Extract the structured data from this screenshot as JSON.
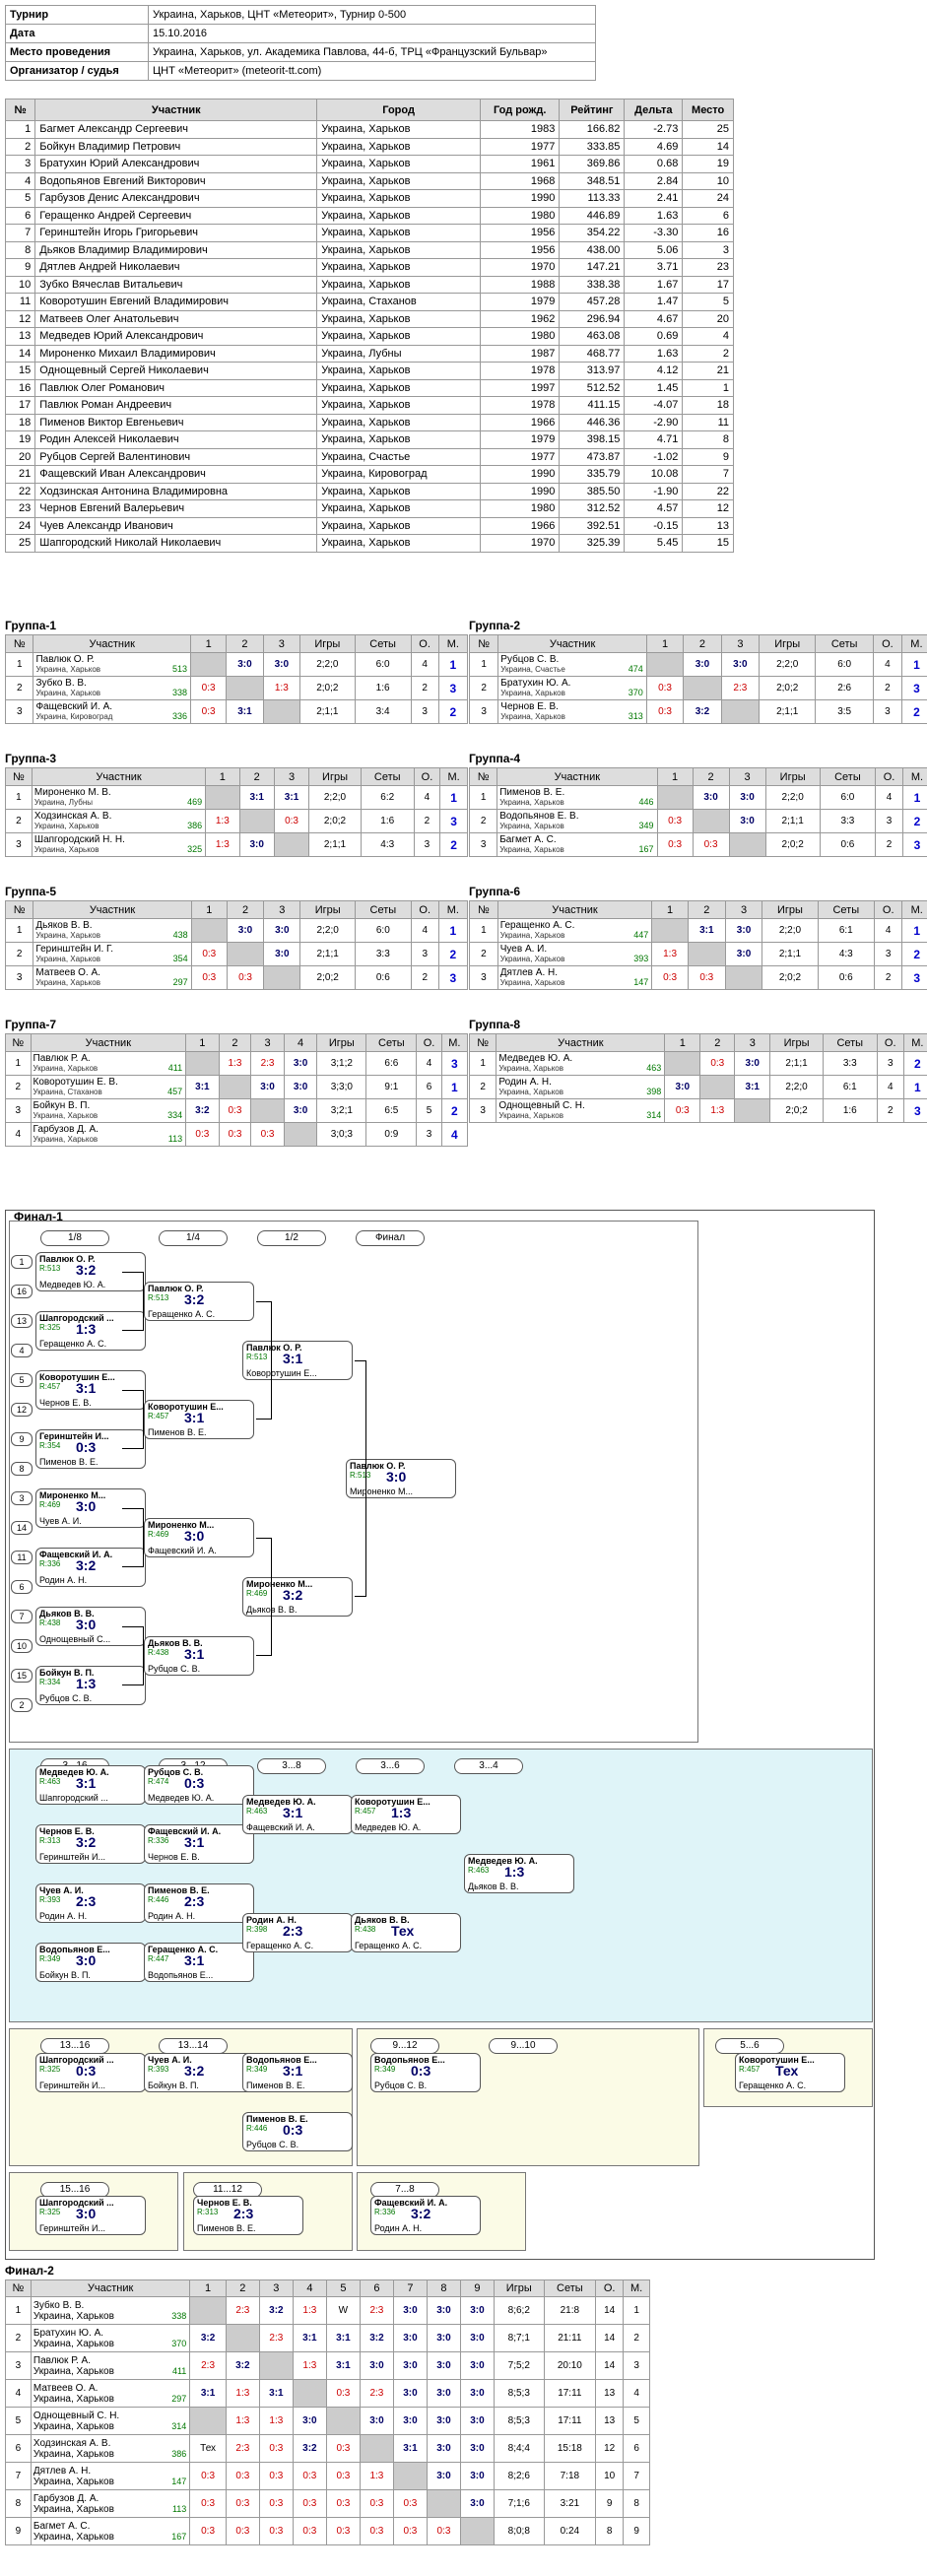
{
  "info": [
    [
      "Турнир",
      "Украина, Харьков, ЦНТ «Метеорит», Турнир 0-500"
    ],
    [
      "Дата",
      "15.10.2016"
    ],
    [
      "Место проведения",
      "Украина, Харьков, ул. Академика Павлова, 44-б, ТРЦ «Французский Бульвар»"
    ],
    [
      "Организатор / судья",
      "ЦНТ «Метеорит» (meteorit-tt.com)"
    ]
  ],
  "players_header": [
    "№",
    "Участник",
    "Город",
    "Год рожд.",
    "Рейтинг",
    "Дельта",
    "Место"
  ],
  "players": [
    [
      "1",
      "Багмет Александр Сергеевич",
      "Украина, Харьков",
      "1983",
      "166.82",
      "-2.73",
      "25"
    ],
    [
      "2",
      "Бойкун Владимир Петрович",
      "Украина, Харьков",
      "1977",
      "333.85",
      "4.69",
      "14"
    ],
    [
      "3",
      "Братухин Юрий Александрович",
      "Украина, Харьков",
      "1961",
      "369.86",
      "0.68",
      "19"
    ],
    [
      "4",
      "Водопьянов Евгений Викторович",
      "Украина, Харьков",
      "1968",
      "348.51",
      "2.84",
      "10"
    ],
    [
      "5",
      "Гарбузов Денис Александрович",
      "Украина, Харьков",
      "1990",
      "113.33",
      "2.41",
      "24"
    ],
    [
      "6",
      "Геращенко Андрей Сергеевич",
      "Украина, Харьков",
      "1980",
      "446.89",
      "1.63",
      "6"
    ],
    [
      "7",
      "Геринштейн Игорь Григорьевич",
      "Украина, Харьков",
      "1956",
      "354.22",
      "-3.30",
      "16"
    ],
    [
      "8",
      "Дьяков Владимир Владимирович",
      "Украина, Харьков",
      "1956",
      "438.00",
      "5.06",
      "3"
    ],
    [
      "9",
      "Дятлев Андрей Николаевич",
      "Украина, Харьков",
      "1970",
      "147.21",
      "3.71",
      "23"
    ],
    [
      "10",
      "Зубко Вячеслав Витальевич",
      "Украина, Харьков",
      "1988",
      "338.38",
      "1.67",
      "17"
    ],
    [
      "11",
      "Коворотушин Евгений Владимирович",
      "Украина, Стаханов",
      "1979",
      "457.28",
      "1.47",
      "5"
    ],
    [
      "12",
      "Матвеев Олег Анатольевич",
      "Украина, Харьков",
      "1962",
      "296.94",
      "4.67",
      "20"
    ],
    [
      "13",
      "Медведев Юрий Александрович",
      "Украина, Харьков",
      "1980",
      "463.08",
      "0.69",
      "4"
    ],
    [
      "14",
      "Мироненко Михаил Владимирович",
      "Украина, Лубны",
      "1987",
      "468.77",
      "1.63",
      "2"
    ],
    [
      "15",
      "Однощевный Сергей Николаевич",
      "Украина, Харьков",
      "1978",
      "313.97",
      "4.12",
      "21"
    ],
    [
      "16",
      "Павлюк Олег Романович",
      "Украина, Харьков",
      "1997",
      "512.52",
      "1.45",
      "1"
    ],
    [
      "17",
      "Павлюк Роман Андреевич",
      "Украина, Харьков",
      "1978",
      "411.15",
      "-4.07",
      "18"
    ],
    [
      "18",
      "Пименов Виктор Евгеньевич",
      "Украина, Харьков",
      "1966",
      "446.36",
      "-2.90",
      "11"
    ],
    [
      "19",
      "Родин Алексей Николаевич",
      "Украина, Харьков",
      "1979",
      "398.15",
      "4.71",
      "8"
    ],
    [
      "20",
      "Рубцов Сергей Валентинович",
      "Украина, Счастье",
      "1977",
      "473.87",
      "-1.02",
      "9"
    ],
    [
      "21",
      "Фащевский Иван Александрович",
      "Украина, Кировоград",
      "1990",
      "335.79",
      "10.08",
      "7"
    ],
    [
      "22",
      "Ходзинская Антонина Владимировна",
      "Украина, Харьков",
      "1990",
      "385.50",
      "-1.90",
      "22"
    ],
    [
      "23",
      "Чернов Евгений Валерьевич",
      "Украина, Харьков",
      "1980",
      "312.52",
      "4.57",
      "12"
    ],
    [
      "24",
      "Чуев Александр Иванович",
      "Украина, Харьков",
      "1966",
      "392.51",
      "-0.15",
      "13"
    ],
    [
      "25",
      "Шапгородский Николай Николаевич",
      "Украина, Харьков",
      "1970",
      "325.39",
      "5.45",
      "15"
    ]
  ],
  "groups": [
    {
      "title": "Группа-1",
      "hdr": [
        "№",
        "Участник",
        "1",
        "2",
        "3",
        "Игры",
        "Сеты",
        "О.",
        "М."
      ],
      "rows": [
        [
          "1",
          "Павлюк О. Р.",
          "Украина, Харьков",
          "513",
          "",
          "3:0",
          "3:0",
          "2;2;0",
          "6:0",
          "4",
          "1"
        ],
        [
          "2",
          "Зубко В. В.",
          "Украина, Харьков",
          "338",
          "0:3",
          "",
          "1:3",
          "2;0;2",
          "1:6",
          "2",
          "3"
        ],
        [
          "3",
          "Фащевский И. А.",
          "Украина, Кировоград",
          "336",
          "0:3",
          "3:1",
          "",
          "2;1;1",
          "3:4",
          "3",
          "2"
        ]
      ]
    },
    {
      "title": "Группа-2",
      "hdr": [
        "№",
        "Участник",
        "1",
        "2",
        "3",
        "Игры",
        "Сеты",
        "О.",
        "М."
      ],
      "rows": [
        [
          "1",
          "Рубцов С. В.",
          "Украина, Счастье",
          "474",
          "",
          "3:0",
          "3:0",
          "2;2;0",
          "6:0",
          "4",
          "1"
        ],
        [
          "2",
          "Братухин Ю. А.",
          "Украина, Харьков",
          "370",
          "0:3",
          "",
          "2:3",
          "2;0;2",
          "2:6",
          "2",
          "3"
        ],
        [
          "3",
          "Чернов Е. В.",
          "Украина, Харьков",
          "313",
          "0:3",
          "3:2",
          "",
          "2;1;1",
          "3:5",
          "3",
          "2"
        ]
      ]
    },
    {
      "title": "Группа-3",
      "hdr": [
        "№",
        "Участник",
        "1",
        "2",
        "3",
        "Игры",
        "Сеты",
        "О.",
        "М."
      ],
      "rows": [
        [
          "1",
          "Мироненко М. В.",
          "Украина, Лубны",
          "469",
          "",
          "3:1",
          "3:1",
          "2;2;0",
          "6:2",
          "4",
          "1"
        ],
        [
          "2",
          "Ходзинская А. В.",
          "Украина, Харьков",
          "386",
          "1:3",
          "",
          "0:3",
          "2;0;2",
          "1:6",
          "2",
          "3"
        ],
        [
          "3",
          "Шапгородский Н. Н.",
          "Украина, Харьков",
          "325",
          "1:3",
          "3:0",
          "",
          "2;1;1",
          "4:3",
          "3",
          "2"
        ]
      ]
    },
    {
      "title": "Группа-4",
      "hdr": [
        "№",
        "Участник",
        "1",
        "2",
        "3",
        "Игры",
        "Сеты",
        "О.",
        "М."
      ],
      "rows": [
        [
          "1",
          "Пименов В. Е.",
          "Украина, Харьков",
          "446",
          "",
          "3:0",
          "3:0",
          "2;2;0",
          "6:0",
          "4",
          "1"
        ],
        [
          "2",
          "Водопьянов Е. В.",
          "Украина, Харьков",
          "349",
          "0:3",
          "",
          "3:0",
          "2;1;1",
          "3:3",
          "3",
          "2"
        ],
        [
          "3",
          "Багмет А. С.",
          "Украина, Харьков",
          "167",
          "0:3",
          "0:3",
          "",
          "2;0;2",
          "0:6",
          "2",
          "3"
        ]
      ]
    },
    {
      "title": "Группа-5",
      "hdr": [
        "№",
        "Участник",
        "1",
        "2",
        "3",
        "Игры",
        "Сеты",
        "О.",
        "М."
      ],
      "rows": [
        [
          "1",
          "Дьяков В. В.",
          "Украина, Харьков",
          "438",
          "",
          "3:0",
          "3:0",
          "2;2;0",
          "6:0",
          "4",
          "1"
        ],
        [
          "2",
          "Геринштейн И. Г.",
          "Украина, Харьков",
          "354",
          "0:3",
          "",
          "3:0",
          "2;1;1",
          "3:3",
          "3",
          "2"
        ],
        [
          "3",
          "Матвеев О. А.",
          "Украина, Харьков",
          "297",
          "0:3",
          "0:3",
          "",
          "2;0;2",
          "0:6",
          "2",
          "3"
        ]
      ]
    },
    {
      "title": "Группа-6",
      "hdr": [
        "№",
        "Участник",
        "1",
        "2",
        "3",
        "Игры",
        "Сеты",
        "О.",
        "М."
      ],
      "rows": [
        [
          "1",
          "Геращенко А. С.",
          "Украина, Харьков",
          "447",
          "",
          "3:1",
          "3:0",
          "2;2;0",
          "6:1",
          "4",
          "1"
        ],
        [
          "2",
          "Чуев А. И.",
          "Украина, Харьков",
          "393",
          "1:3",
          "",
          "3:0",
          "2;1;1",
          "4:3",
          "3",
          "2"
        ],
        [
          "3",
          "Дятлев А. Н.",
          "Украина, Харьков",
          "147",
          "0:3",
          "0:3",
          "",
          "2;0;2",
          "0:6",
          "2",
          "3"
        ]
      ]
    },
    {
      "title": "Группа-7",
      "hdr": [
        "№",
        "Участник",
        "1",
        "2",
        "3",
        "4",
        "Игры",
        "Сеты",
        "О.",
        "М."
      ],
      "rows": [
        [
          "1",
          "Павлюк Р. А.",
          "Украина, Харьков",
          "411",
          "",
          "1:3",
          "2:3",
          "3:0",
          "3;1;2",
          "6:6",
          "4",
          "3"
        ],
        [
          "2",
          "Коворотушин Е. В.",
          "Украина, Стаханов",
          "457",
          "3:1",
          "",
          "3:0",
          "3:0",
          "3;3;0",
          "9:1",
          "6",
          "1"
        ],
        [
          "3",
          "Бойкун В. П.",
          "Украина, Харьков",
          "334",
          "3:2",
          "0:3",
          "",
          "3:0",
          "3;2;1",
          "6:5",
          "5",
          "2"
        ],
        [
          "4",
          "Гарбузов Д. А.",
          "Украина, Харьков",
          "113",
          "0:3",
          "0:3",
          "0:3",
          "",
          "3;0;3",
          "0:9",
          "3",
          "4"
        ]
      ]
    },
    {
      "title": "Группа-8",
      "hdr": [
        "№",
        "Участник",
        "1",
        "2",
        "3",
        "Игры",
        "Сеты",
        "О.",
        "М."
      ],
      "rows": [
        [
          "1",
          "Медведев Ю. А.",
          "Украина, Харьков",
          "463",
          "",
          "0:3",
          "3:0",
          "2;1;1",
          "3:3",
          "3",
          "2"
        ],
        [
          "2",
          "Родин А. Н.",
          "Украина, Харьков",
          "398",
          "3:0",
          "",
          "3:1",
          "2;2;0",
          "6:1",
          "4",
          "1"
        ],
        [
          "3",
          "Однощевный С. Н.",
          "Украина, Харьков",
          "314",
          "0:3",
          "1:3",
          "",
          "2;0;2",
          "1:6",
          "2",
          "3"
        ]
      ]
    }
  ],
  "final1": {
    "title": "Финал-1",
    "rounds": [
      "1/8",
      "1/4",
      "1/2",
      "Финал",
      "3...16",
      "3...12",
      "3...8",
      "3...6",
      "3...4",
      "13...16",
      "13...14",
      "9...12",
      "9...10",
      "5...6",
      "15...16",
      "11...12",
      "7...8"
    ],
    "boxes": [
      [
        "Павлюк О. Р.",
        "R:513",
        "3:2",
        "Медведев Ю. А.",
        "R:463"
      ],
      [
        "Шапгородский ...",
        "R:325",
        "1:3",
        "Геращенко А. С.",
        "R:447"
      ],
      [
        "Коворотушин Е...",
        "R:457",
        "3:1",
        "Чернов Е. В.",
        "R:313"
      ],
      [
        "Геринштейн И...",
        "R:354",
        "0:3",
        "Пименов В. Е.",
        "R:446"
      ],
      [
        "Мироненко М...",
        "R:469",
        "3:0",
        "Чуев А. И.",
        "R:393"
      ],
      [
        "Фащевский И. А.",
        "R:336",
        "3:2",
        "Родин А. Н.",
        "R:398"
      ],
      [
        "Дьяков В. В.",
        "R:438",
        "3:0",
        "Однощевный С...",
        "R:314"
      ],
      [
        "Бойкун В. П.",
        "R:334",
        "1:3",
        "Рубцов С. В.",
        "R:474"
      ],
      [
        "Павлюк О. Р.",
        "R:513",
        "3:2",
        "Геращенко А. С.",
        "R:447"
      ],
      [
        "Коворотушин Е...",
        "R:457",
        "3:1",
        "Пименов В. Е.",
        "R:446"
      ],
      [
        "Мироненко М...",
        "R:469",
        "3:0",
        "Фащевский И. А.",
        "R:336"
      ],
      [
        "Дьяков В. В.",
        "R:438",
        "3:1",
        "Рубцов С. В.",
        "R:474"
      ],
      [
        "Павлюк О. Р.",
        "R:513",
        "3:1",
        "Коворотушин Е...",
        "R:457"
      ],
      [
        "Мироненко М...",
        "R:469",
        "3:2",
        "Дьяков В. В.",
        "R:438"
      ],
      [
        "Павлюк О. Р.",
        "R:513",
        "3:0",
        "Мироненко М...",
        "R:469"
      ],
      [
        "Медведев Ю. А.",
        "R:463",
        "3:1",
        "Шапгородский ...",
        "R:325"
      ],
      [
        "Чернов Е. В.",
        "R:313",
        "3:2",
        "Геринштейн И...",
        "R:354"
      ],
      [
        "Чуев А. И.",
        "R:393",
        "2:3",
        "Родин А. Н.",
        "R:398"
      ],
      [
        "Водопьянов Е...",
        "R:349",
        "3:0",
        "Бойкун В. П.",
        "R:334"
      ],
      [
        "Рубцов С. В.",
        "R:474",
        "0:3",
        "Медведев Ю. А.",
        "R:463"
      ],
      [
        "Фащевский И. А.",
        "R:336",
        "3:1",
        "Чернов Е. В.",
        "R:313"
      ],
      [
        "Пименов В. Е.",
        "R:446",
        "2:3",
        "Родин А. Н.",
        "R:398"
      ],
      [
        "Геращенко А. С.",
        "R:447",
        "3:1",
        "Водопьянов Е...",
        "R:349"
      ],
      [
        "Медведев Ю. А.",
        "R:463",
        "3:1",
        "Фащевский И. А.",
        "R:336"
      ],
      [
        "Родин А. Н.",
        "R:398",
        "2:3",
        "Геращенко А. С.",
        "R:447"
      ],
      [
        "Коворотушин Е...",
        "R:457",
        "1:3",
        "Медведев Ю. А.",
        "R:463"
      ],
      [
        "Дьяков В. В.",
        "R:438",
        "Тех",
        "Геращенко А. С.",
        "R:447"
      ],
      [
        "Медведев Ю. А.",
        "R:463",
        "1:3",
        "Дьяков В. В.",
        "R:438"
      ],
      [
        "Шапгородский ...",
        "R:325",
        "0:3",
        "Геринштейн И...",
        "R:354"
      ],
      [
        "Чуев А. И.",
        "R:393",
        "3:2",
        "Бойкун В. П.",
        "R:334"
      ],
      [
        "Водопьянов Е...",
        "R:349",
        "3:1",
        "Пименов В. Е.",
        "R:446"
      ],
      [
        "Пименов В. Е.",
        "R:446",
        "0:3",
        "Рубцов С. В.",
        "R:474"
      ],
      [
        "Водопьянов Е...",
        "R:349",
        "0:3",
        "Рубцов С. В.",
        "R:474"
      ],
      [
        "Коворотушин Е...",
        "R:457",
        "Тех",
        "Геращенко А. С.",
        "R:447"
      ],
      [
        "Шапгородский ...",
        "R:325",
        "3:0",
        "Геринштейн И...",
        "R:354"
      ],
      [
        "Чернов Е. В.",
        "R:313",
        "2:3",
        "Пименов В. Е.",
        "R:446"
      ],
      [
        "Фащевский И. А.",
        "R:336",
        "3:2",
        "Родин А. Н.",
        "R:398"
      ]
    ],
    "seeds": [
      "1",
      "16",
      "13",
      "4",
      "5",
      "12",
      "9",
      "8",
      "3",
      "14",
      "11",
      "6",
      "7",
      "10",
      "15",
      "2"
    ]
  },
  "final2": {
    "title": "Финал-2",
    "hdr": [
      "№",
      "Участник",
      "1",
      "2",
      "3",
      "4",
      "5",
      "6",
      "7",
      "8",
      "9",
      "Игры",
      "Сеты",
      "О.",
      "М."
    ],
    "rows": [
      [
        "1",
        "Зубко В. В.",
        "Украина, Харьков",
        "338",
        "",
        "2:3",
        "3:2",
        "1:3",
        "W",
        "2:3",
        "3:0",
        "3:0",
        "3:0",
        "8;6;2",
        "21:8",
        "14",
        "1"
      ],
      [
        "2",
        "Братухин Ю. А.",
        "Украина, Харьков",
        "370",
        "3:2",
        "",
        "2:3",
        "3:1",
        "3:1",
        "3:2",
        "3:0",
        "3:0",
        "3:0",
        "8;7;1",
        "21:11",
        "14",
        "2"
      ],
      [
        "3",
        "Павлюк Р. А.",
        "Украина, Харьков",
        "411",
        "2:3",
        "3:2",
        "",
        "1:3",
        "3:1",
        "3:0",
        "3:0",
        "3:0",
        "3:0",
        "7;5;2",
        "20:10",
        "14",
        "3"
      ],
      [
        "4",
        "Матвеев О. А.",
        "Украина, Харьков",
        "297",
        "3:1",
        "1:3",
        "3:1",
        "",
        "0:3",
        "2:3",
        "3:0",
        "3:0",
        "3:0",
        "8;5;3",
        "17:11",
        "13",
        "4"
      ],
      [
        "5",
        "Однощевный С. Н.",
        "Украина, Харьков",
        "314",
        "",
        "1:3",
        "1:3",
        "3:0",
        "",
        "3:0",
        "3:0",
        "3:0",
        "3:0",
        "8;5;3",
        "17:11",
        "13",
        "5"
      ],
      [
        "6",
        "Ходзинская А. В.",
        "Украина, Харьков",
        "386",
        "Тех",
        "2:3",
        "0:3",
        "3:2",
        "0:3",
        "",
        "3:1",
        "3:0",
        "3:0",
        "8;4;4",
        "15:18",
        "12",
        "6"
      ],
      [
        "7",
        "Дятлев А. Н.",
        "Украина, Харьков",
        "147",
        "0:3",
        "0:3",
        "0:3",
        "0:3",
        "0:3",
        "1:3",
        "",
        "3:0",
        "3:0",
        "8;2;6",
        "7:18",
        "10",
        "7"
      ],
      [
        "8",
        "Гарбузов Д. А.",
        "Украина, Харьков",
        "113",
        "0:3",
        "0:3",
        "0:3",
        "0:3",
        "0:3",
        "0:3",
        "0:3",
        "",
        "3:0",
        "7;1;6",
        "3:21",
        "9",
        "8"
      ],
      [
        "9",
        "Багмет А. С.",
        "Украина, Харьков",
        "167",
        "0:3",
        "0:3",
        "0:3",
        "0:3",
        "0:3",
        "0:3",
        "0:3",
        "0:3",
        "",
        "8;0;8",
        "0:24",
        "8",
        "9"
      ]
    ]
  }
}
